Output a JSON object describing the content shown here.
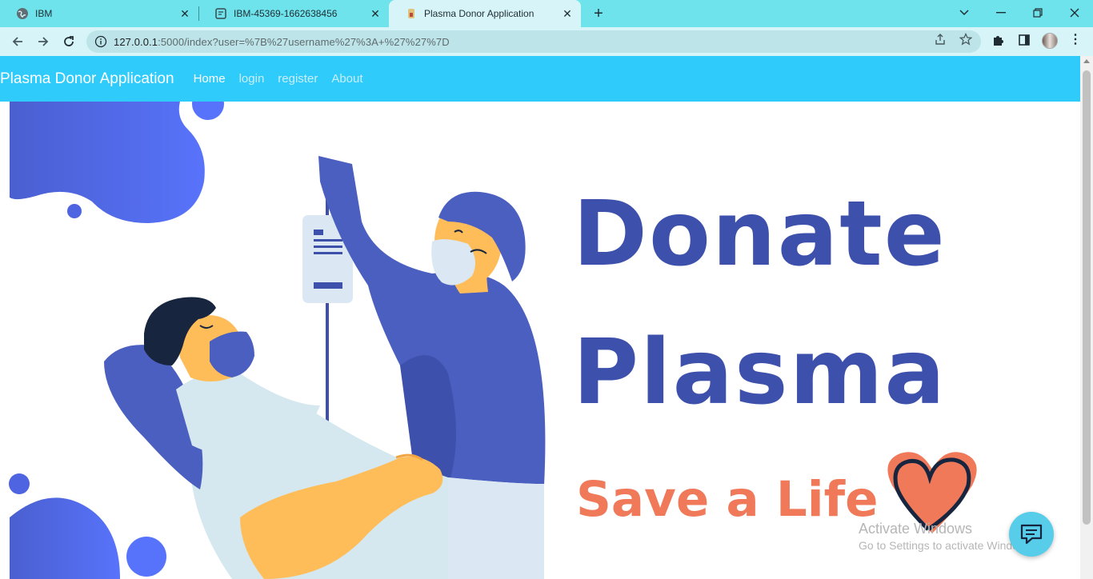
{
  "browser": {
    "tabs": [
      {
        "title": "IBM",
        "icon": "globe-icon"
      },
      {
        "title": "IBM-45369-1662638456",
        "icon": "doc-icon"
      },
      {
        "title": "Plasma Donor Application",
        "icon": "blood-bag-icon",
        "active": true
      }
    ],
    "url_host": "127.0.0.1",
    "url_rest": ":5000/index?user=%7B%27username%27%3A+%27%27%7D"
  },
  "navbar": {
    "brand": "Plasma Donor Application",
    "links": [
      "Home",
      "login",
      "register",
      "About"
    ],
    "active": "Home"
  },
  "hero": {
    "line1": "Donate",
    "line2": "Plasma",
    "tagline": "Save a Life"
  },
  "watermark": {
    "line1": "Activate Windows",
    "line2": "Go to Settings to activate Windows."
  },
  "colors": {
    "navbar": "#2fcbfa",
    "headline": "#3d50ac",
    "tagline": "#f0795a",
    "tabstrip": "#6fe3ec"
  }
}
